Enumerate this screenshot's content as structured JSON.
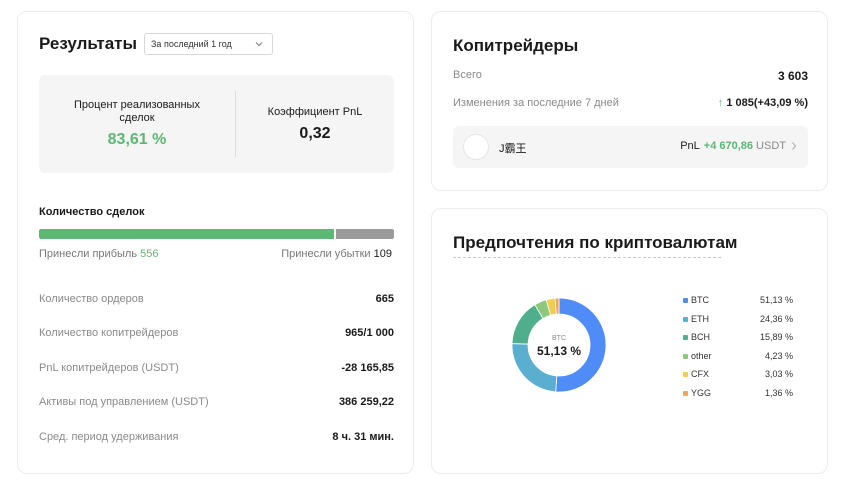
{
  "results": {
    "title": "Результаты",
    "period": "За последний 1 год",
    "realized_label": "Процент реализованных сделок",
    "realized_value": "83,61 %",
    "pnl_ratio_label": "Коэффициент PnL",
    "pnl_ratio_value": "0,32",
    "deals_label": "Количество сделок",
    "profit_label": "Принесли прибыль",
    "profit_count": "556",
    "loss_label": "Принесли убытки",
    "loss_count": "109",
    "win_fraction": 0.8361,
    "rows": [
      {
        "label": "Количество ордеров",
        "value": "665"
      },
      {
        "label": "Количество копитрейдеров",
        "value": "965/1 000"
      },
      {
        "label": "PnL копитрейдеров (USDT)",
        "value": "-28 165,85"
      },
      {
        "label": "Активы под управлением (USDT)",
        "value": "386 259,22"
      },
      {
        "label": "Сред. период удерживания",
        "value": "8 ч. 31 мин."
      }
    ]
  },
  "copy": {
    "title": "Копитрейдеры",
    "total_label": "Всего",
    "total_value": "3 603",
    "change_label": "Изменения за последние 7 дней",
    "change_arrow": "↑",
    "change_value": "1 085(+43,09 %)",
    "trader_name": "J霸王",
    "trader_pnl_label": "PnL",
    "trader_pnl_value": "+4 670,86",
    "trader_pnl_unit": "USDT"
  },
  "pref": {
    "title": "Предпочтения по криптовалютам",
    "center_label": "BTC",
    "center_value": "51,13 %",
    "items": [
      {
        "name": "BTC",
        "pct": "51,13 %",
        "value": 51.13,
        "color": "#4f8cf7"
      },
      {
        "name": "ETH",
        "pct": "24,36 %",
        "value": 24.36,
        "color": "#5aaed0"
      },
      {
        "name": "BCH",
        "pct": "15,89 %",
        "value": 15.89,
        "color": "#4fae8c"
      },
      {
        "name": "other",
        "pct": "4,23 %",
        "value": 4.23,
        "color": "#8cc97a"
      },
      {
        "name": "CFX",
        "pct": "3,03 %",
        "value": 3.03,
        "color": "#f2cb56"
      },
      {
        "name": "YGG",
        "pct": "1,36 %",
        "value": 1.36,
        "color": "#f0a35c"
      }
    ]
  },
  "colors": {
    "green": "#5cb872",
    "gray_bar": "#9a9a9a"
  }
}
